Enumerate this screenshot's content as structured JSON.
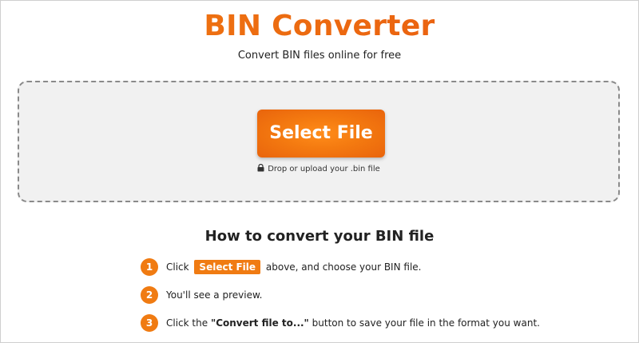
{
  "header": {
    "title": "BIN Converter",
    "subtitle": "Convert BIN files online for free"
  },
  "dropzone": {
    "button_label": "Select File",
    "hint": "Drop or upload your .bin file",
    "hint_icon": "lock-icon"
  },
  "howto": {
    "title": "How to convert your BIN file",
    "steps": [
      {
        "number": "1",
        "prefix": "Click",
        "button_label": "Select File",
        "suffix": "above, and choose your BIN file."
      },
      {
        "number": "2",
        "text": "You'll see a preview."
      },
      {
        "number": "3",
        "prefix": "Click the",
        "bold": "\"Convert file to...\"",
        "suffix": "button to save your file in the format you want."
      }
    ]
  },
  "colors": {
    "accent": "#f07b12",
    "accent_dark": "#e9640c",
    "dropzone_bg": "#f1f1f1",
    "dropzone_border": "#8a8a8a"
  }
}
